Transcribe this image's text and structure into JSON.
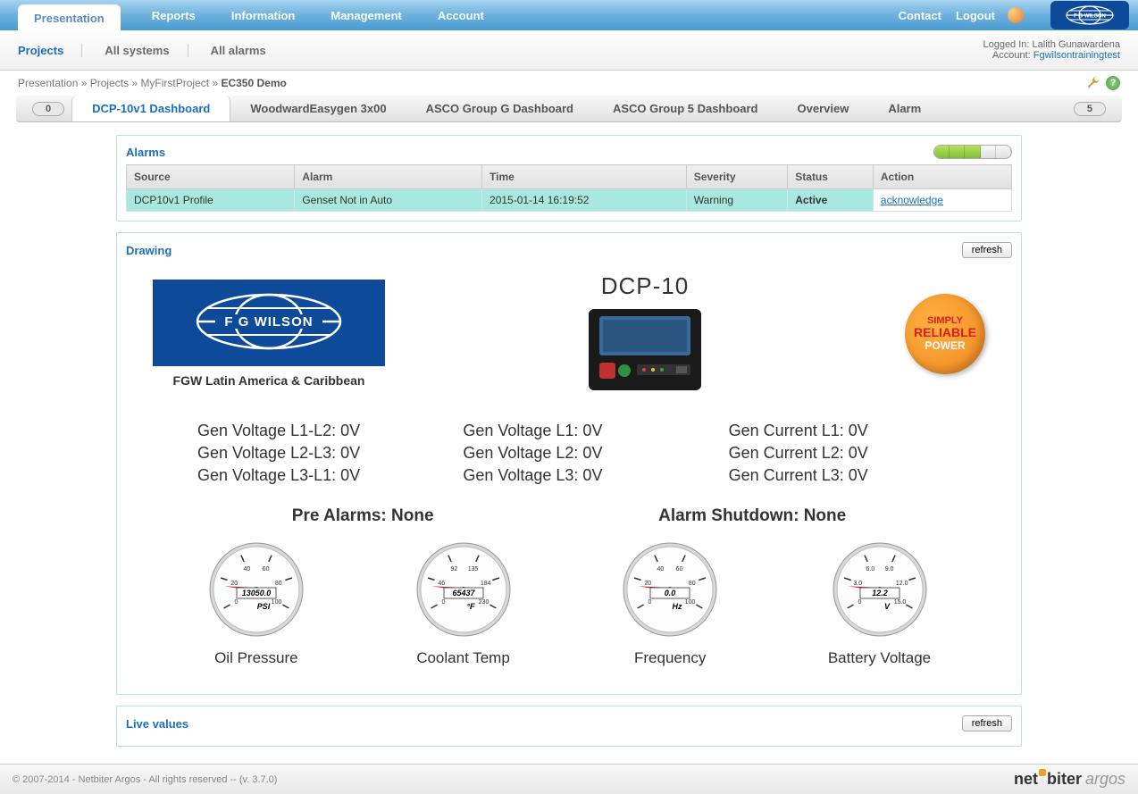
{
  "topnav": {
    "active_tab": "Presentation",
    "items": [
      "Reports",
      "Information",
      "Management",
      "Account"
    ],
    "contact": "Contact",
    "logout": "Logout",
    "brand": "F G WILSON"
  },
  "subnav": {
    "items": [
      {
        "label": "Projects",
        "active": true
      },
      {
        "label": "All systems",
        "active": false
      },
      {
        "label": "All alarms",
        "active": false
      }
    ],
    "logged_in_label": "Logged In:",
    "logged_in_user": "Lalith Gunawardena",
    "account_label": "Account:",
    "account_name": "Fgwilsontrainingtest"
  },
  "breadcrumb": {
    "parts": [
      "Presentation",
      "Projects",
      "MyFirstProject"
    ],
    "current": "EC350 Demo"
  },
  "pagetabs": {
    "left_badge": "0",
    "right_badge": "5",
    "items": [
      {
        "label": "DCP-10v1 Dashboard",
        "active": true
      },
      {
        "label": "WoodwardEasygen 3x00",
        "active": false
      },
      {
        "label": "ASCO Group G Dashboard",
        "active": false
      },
      {
        "label": "ASCO Group 5 Dashboard",
        "active": false
      },
      {
        "label": "Overview",
        "active": false
      },
      {
        "label": "Alarm",
        "active": false
      }
    ]
  },
  "alarms_panel": {
    "title": "Alarms",
    "headers": [
      "Source",
      "Alarm",
      "Time",
      "Severity",
      "Status",
      "Action"
    ],
    "row": {
      "source": "DCP10v1 Profile",
      "alarm": "Genset Not in Auto",
      "time": "2015-01-14 16:19:52",
      "severity": "Warning",
      "status": "Active",
      "action": "acknowledge"
    },
    "signal_level": 3
  },
  "drawing_panel": {
    "title": "Drawing",
    "refresh": "refresh",
    "fgw_logo_text": "F G WILSON",
    "fgw_caption": "FGW Latin America & Caribbean",
    "dcp_title": "DCP-10",
    "srp_lines": [
      "SIMPLY",
      "RELIABLE",
      "POWER"
    ],
    "values": {
      "col1": [
        "Gen Voltage L1-L2: 0V",
        "Gen Voltage L2-L3: 0V",
        "Gen Voltage L3-L1: 0V"
      ],
      "col2": [
        "Gen Voltage L1: 0V",
        "Gen Voltage L2: 0V",
        "Gen Voltage L3: 0V"
      ],
      "col3": [
        "Gen Current L1: 0V",
        "Gen Current L2: 0V",
        "Gen Current L3: 0V"
      ]
    },
    "pre_alarms": "Pre Alarms: None",
    "alarm_shutdown": "Alarm Shutdown: None",
    "gauges": [
      {
        "label": "Oil Pressure",
        "value": "13050.0",
        "unit": "PSI",
        "ticks": [
          "0",
          "20",
          "40",
          "60",
          "80",
          "100"
        ]
      },
      {
        "label": "Coolant Temp",
        "value": "65437",
        "unit": "°F",
        "ticks": [
          "0",
          "46",
          "92",
          "135",
          "184",
          "230"
        ]
      },
      {
        "label": "Frequency",
        "value": "0.0",
        "unit": "Hz",
        "ticks": [
          "0",
          "20",
          "40",
          "60",
          "80",
          "100"
        ]
      },
      {
        "label": "Battery Voltage",
        "value": "12.2",
        "unit": "V",
        "ticks": [
          "0",
          "3.0",
          "6.0",
          "9.0",
          "12.0",
          "15.0"
        ]
      }
    ]
  },
  "live_values_panel": {
    "title": "Live values",
    "refresh": "refresh"
  },
  "footer": {
    "copyright": "© 2007-2014 - Netbiter Argos - All rights reserved -- (v. 3.7.0)",
    "brand1": "net",
    "brand2": "biter",
    "brand3": "argos"
  }
}
